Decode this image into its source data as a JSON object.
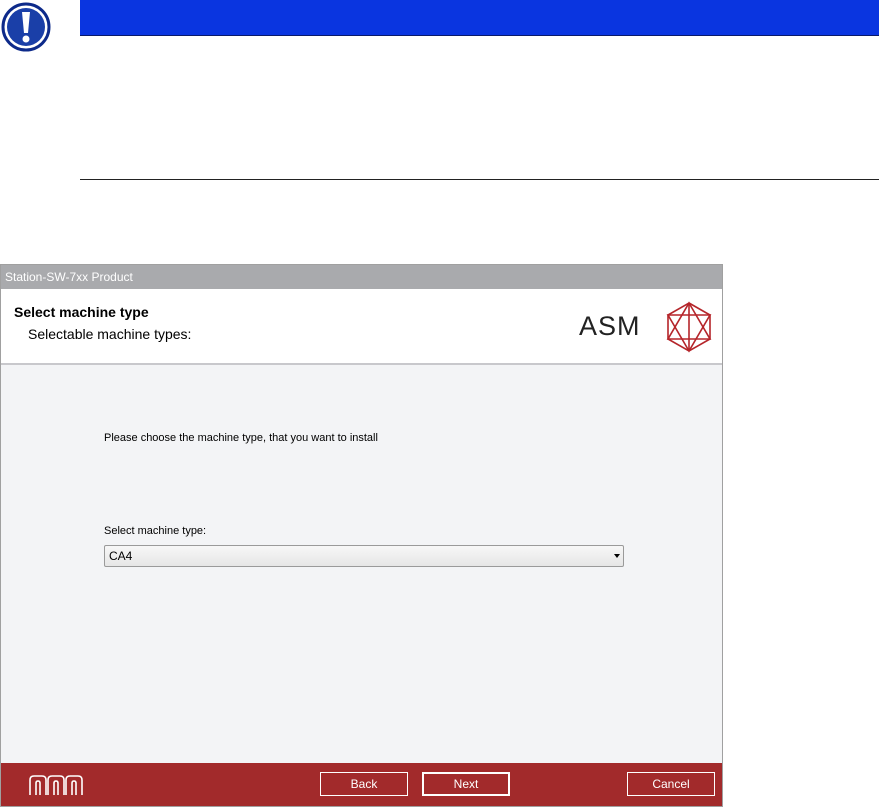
{
  "notice": {
    "icon": "exclamation-warning-icon",
    "bar_color": "#0a35e0"
  },
  "window": {
    "title": "Station-SW-7xx Product",
    "header": {
      "title": "Select machine type",
      "subtitle": "Selectable machine types:",
      "logo_text": "ASM"
    },
    "content": {
      "prompt": "Please choose the machine type, that you want to install",
      "select_label": "Select machine type:",
      "select_value": "CA4"
    },
    "footer": {
      "back_label": "Back",
      "next_label": "Next",
      "cancel_label": "Cancel",
      "background": "#a22a2b"
    }
  }
}
